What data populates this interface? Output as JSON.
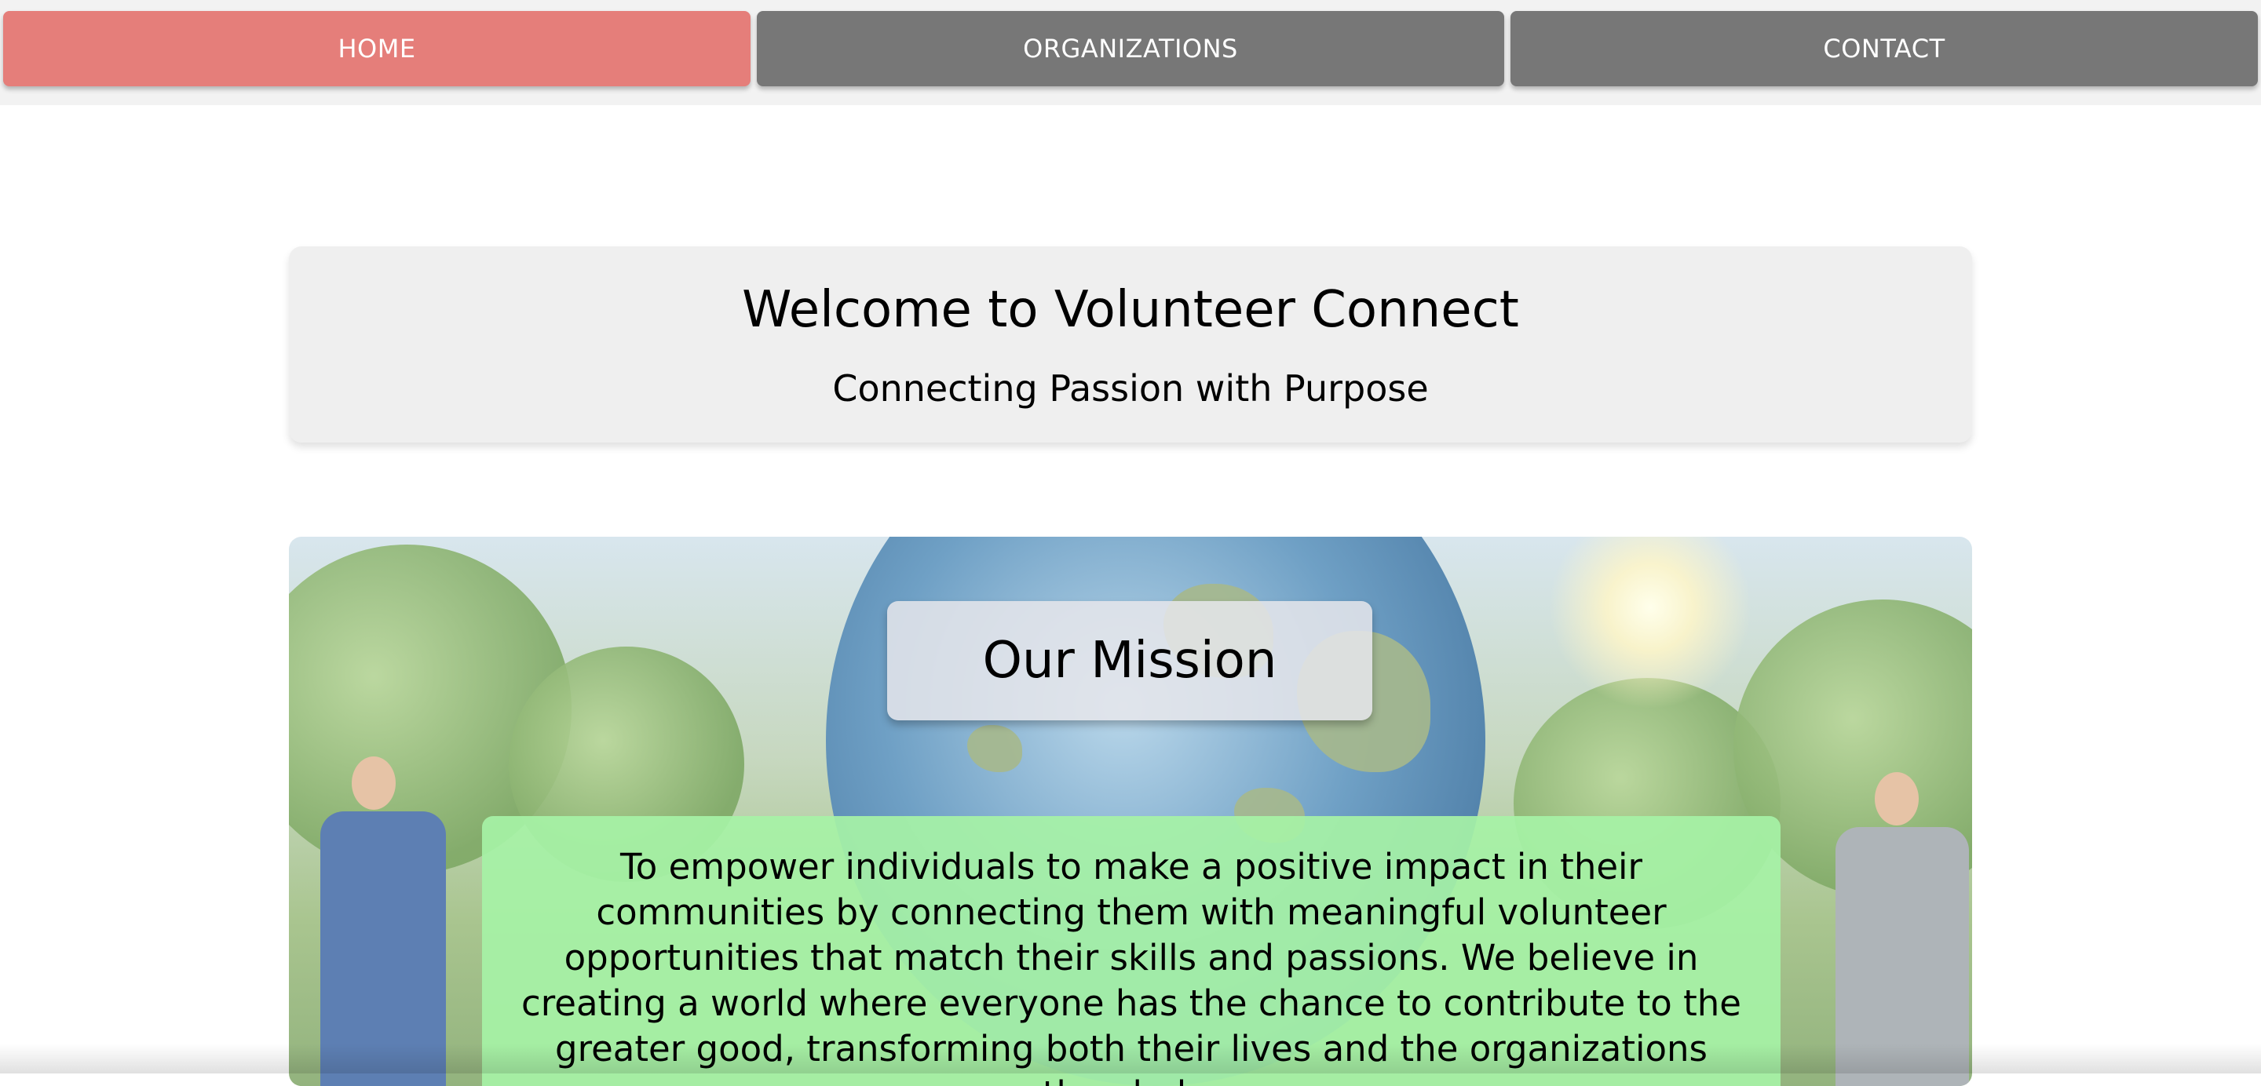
{
  "nav": {
    "items": [
      {
        "label": "HOME",
        "active": true
      },
      {
        "label": "ORGANIZATIONS",
        "active": false
      },
      {
        "label": "CONTACT",
        "active": false
      }
    ],
    "active_color": "#e57e7a",
    "inactive_color": "#777777"
  },
  "welcome": {
    "title": "Welcome to Volunteer Connect",
    "subtitle": "Connecting Passion with Purpose"
  },
  "mission": {
    "title": "Our Mission",
    "text": "To empower individuals to make a positive impact in their communities by connecting them with meaningful volunteer opportunities that match their skills and passions. We believe in creating a world where everyone has the chance to contribute to the greater good, transforming both their lives and the organizations they help.",
    "text_box_color": "#a6f2a6"
  }
}
